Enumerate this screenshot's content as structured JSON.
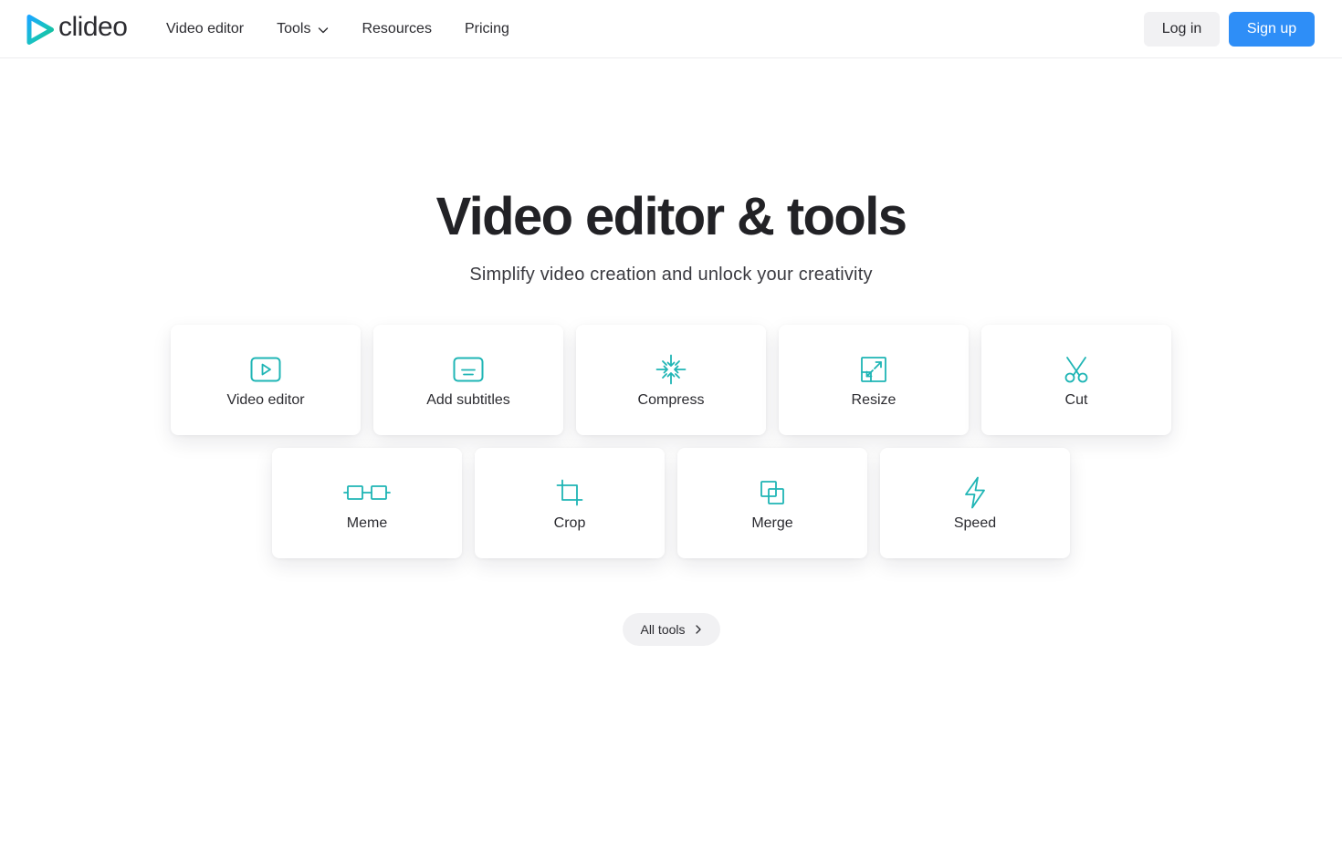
{
  "brand": {
    "name": "clideo",
    "accent_teal": "#1fb5b5",
    "accent_blue": "#2e8ef7"
  },
  "nav": {
    "items": [
      {
        "label": "Video editor"
      },
      {
        "label": "Tools",
        "icon": "chevron-down-icon"
      },
      {
        "label": "Resources"
      },
      {
        "label": "Pricing"
      }
    ]
  },
  "auth": {
    "login_label": "Log in",
    "signup_label": "Sign up"
  },
  "hero": {
    "title": "Video editor & tools",
    "subtitle": "Simplify video creation and unlock your creativity"
  },
  "tools": [
    {
      "label": "Video editor",
      "icon": "play-icon"
    },
    {
      "label": "Add subtitles",
      "icon": "subtitles-icon"
    },
    {
      "label": "Compress",
      "icon": "compress-icon"
    },
    {
      "label": "Resize",
      "icon": "resize-icon"
    },
    {
      "label": "Cut",
      "icon": "scissors-icon"
    },
    {
      "label": "Meme",
      "icon": "meme-icon"
    },
    {
      "label": "Crop",
      "icon": "crop-icon"
    },
    {
      "label": "Merge",
      "icon": "merge-icon"
    },
    {
      "label": "Speed",
      "icon": "lightning-icon"
    }
  ],
  "all_tools": {
    "label": "All tools",
    "icon": "chevron-right-icon"
  }
}
